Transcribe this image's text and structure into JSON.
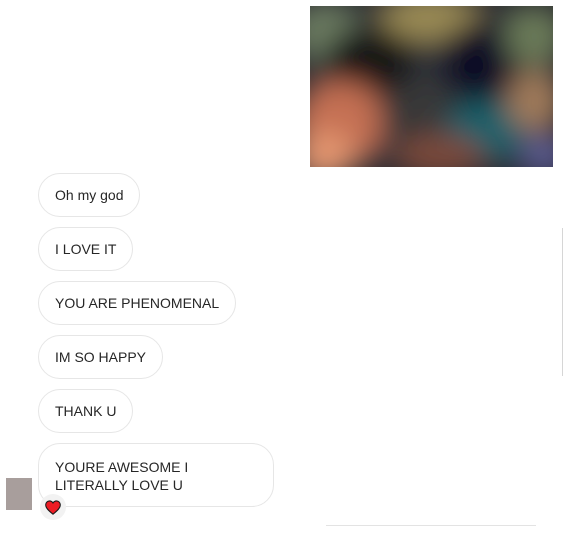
{
  "shared_image": {
    "icon": "blurred-photo",
    "alt": ""
  },
  "messages": [
    {
      "text": "Oh my god"
    },
    {
      "text": "I LOVE IT"
    },
    {
      "text": "YOU ARE PHENOMENAL"
    },
    {
      "text": "IM SO HAPPY"
    },
    {
      "text": "THANK U"
    },
    {
      "text": "YOURE AWESOME I LITERALLY LOVE U"
    }
  ],
  "reaction": {
    "icon": "heart-icon",
    "color": "#ed1c24"
  },
  "colors": {
    "bubble_border": "#e6e6e6",
    "text": "#262626",
    "avatar": "#a89e9c"
  }
}
